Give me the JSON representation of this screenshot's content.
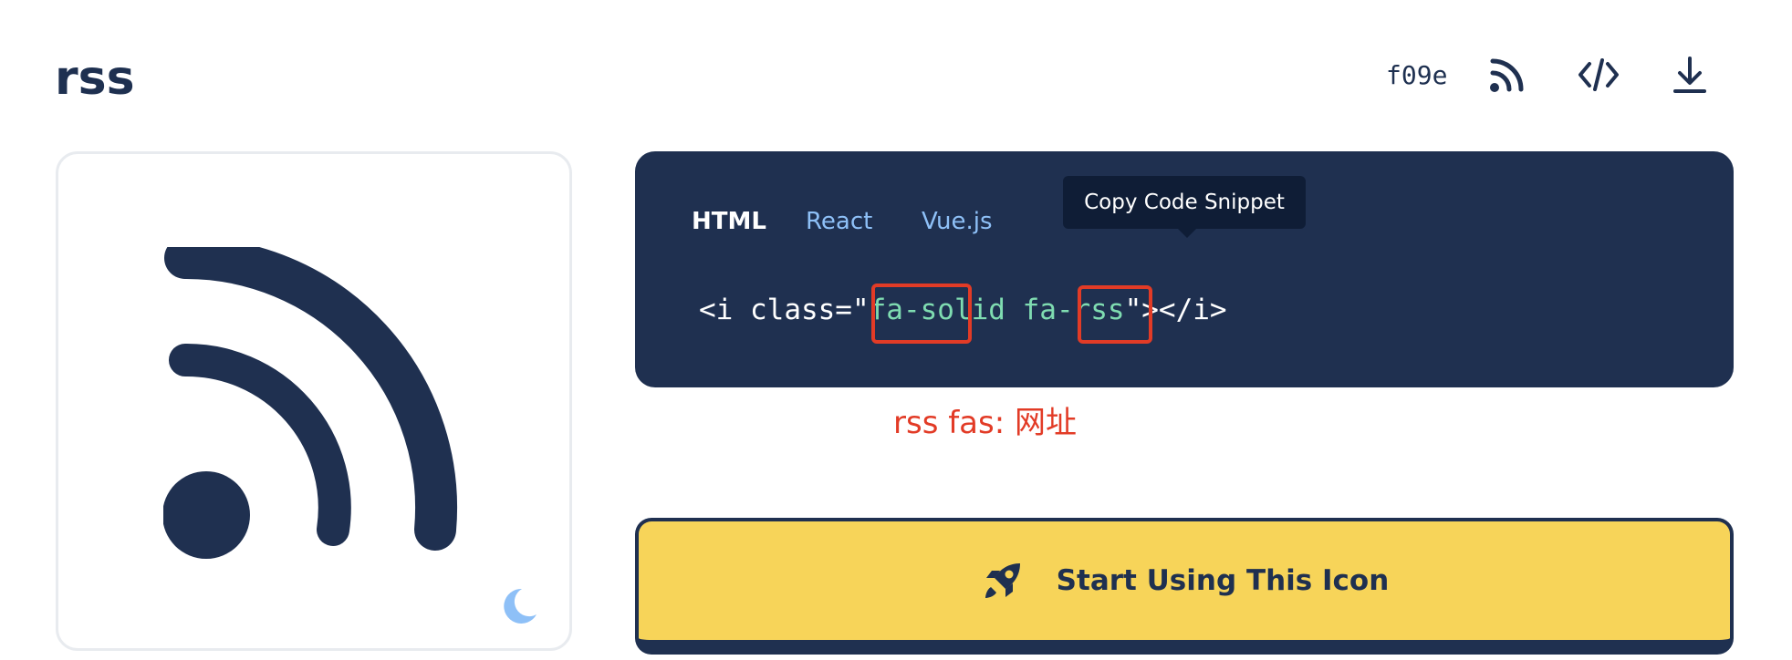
{
  "icon": {
    "name": "rss",
    "unicode": "f09e"
  },
  "header_actions": [
    {
      "icon": "rss-icon",
      "label": "Preview icon"
    },
    {
      "icon": "code-icon",
      "label": "Code"
    },
    {
      "icon": "download-icon",
      "label": "Download"
    }
  ],
  "preview": {
    "icon": "rss-icon",
    "theme_toggle_icon": "moon-icon"
  },
  "code": {
    "tabs": [
      {
        "label": "HTML",
        "active": true
      },
      {
        "label": "React",
        "active": false
      },
      {
        "label": "Vue.js",
        "active": false
      }
    ],
    "tooltip": "Copy Code Snippet",
    "snippet": {
      "open": "<i class=\"",
      "class_value": "fa-solid fa-rss",
      "close": "\"></i>"
    }
  },
  "annotation": "rss fas: 网址",
  "cta": {
    "label": "Start Using This Icon",
    "icon": "rocket-icon"
  },
  "colors": {
    "navy": "#1f3050",
    "accent_yellow": "#f7d459",
    "tab_inactive": "#8ec0f7",
    "code_string": "#7fdcb1",
    "annotation_red": "#e23b26",
    "moon_blue": "#8ec0f7"
  }
}
